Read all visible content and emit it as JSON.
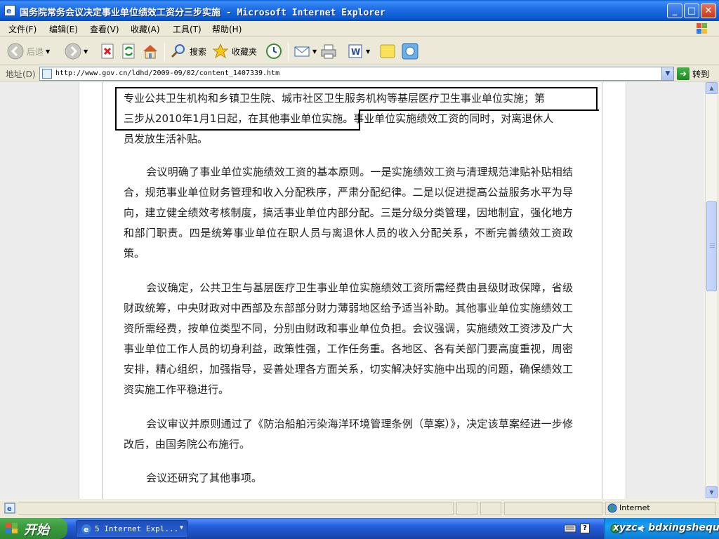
{
  "window": {
    "title": "国务院常务会议决定事业单位绩效工资分三步实施 - Microsoft Internet Explorer"
  },
  "menu": [
    "文件(F)",
    "编辑(E)",
    "查看(V)",
    "收藏(A)",
    "工具(T)",
    "帮助(H)"
  ],
  "toolbar": {
    "back_label": "后退",
    "search_label": "搜索",
    "favorites_label": "收藏夹"
  },
  "address": {
    "label": "地址(D)",
    "url": "http://www.gov.cn/ldhd/2009-09/02/content_1407339.htm",
    "go_label": "转到"
  },
  "article": {
    "para1_line1": "专业公共卫生机构和乡镇卫生院、城市社区卫生服务机构等基层医疗卫生事业单位实施；第",
    "para1_line2": "三步从2010年1月1日起，在其他事业单位实施。事业单位实施绩效工资的同时，对离退休人",
    "para1_line3": "员发放生活补贴。",
    "para2": "会议明确了事业单位实施绩效工资的基本原则。一是实施绩效工资与清理规范津贴补贴相结合，规范事业单位财务管理和收入分配秩序，严肃分配纪律。二是以促进提高公益服务水平为导向，建立健全绩效考核制度，搞活事业单位内部分配。三是分级分类管理，因地制宜，强化地方和部门职责。四是统筹事业单位在职人员与离退休人员的收入分配关系，不断完善绩效工资政策。",
    "para3": "会议确定，公共卫生与基层医疗卫生事业单位实施绩效工资所需经费由县级财政保障，省级财政统筹，中央财政对中西部及东部部分财力薄弱地区给予适当补助。其他事业单位实施绩效工资所需经费，按单位类型不同，分别由财政和事业单位负担。会议强调，实施绩效工资涉及广大事业单位工作人员的切身利益，政策性强，工作任务重。各地区、各有关部门要高度重视，周密安排，精心组织，加强指导，妥善处理各方面关系，切实解决好实施中出现的问题，确保绩效工资实施工作平稳进行。",
    "para4": "会议审议并原则通过了《防治船舶污染海洋环境管理条例（草案）》，决定该草案经进一步修改后，由国务院公布施行。",
    "para5": "会议还研究了其他事项。"
  },
  "status": {
    "zone": "Internet"
  },
  "taskbar": {
    "start_label": "开始",
    "task_label": "5 Internet Expl...",
    "watermark": "xyzc - bdxingshequ"
  },
  "colors": {
    "titlebar": "#0b58d0",
    "taskbar": "#245edb",
    "start": "#3c9c3f",
    "highlight_box": "#000000"
  }
}
